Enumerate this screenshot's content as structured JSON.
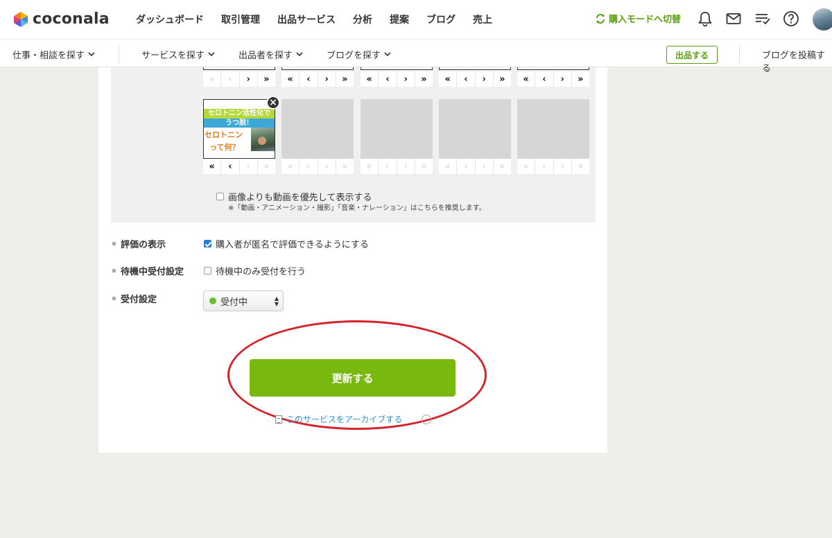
{
  "brand": {
    "name": "coconala"
  },
  "header": {
    "nav": [
      "ダッシュボード",
      "取引管理",
      "出品サービス",
      "分析",
      "提案",
      "ブログ",
      "売上"
    ],
    "mode_switch": "購入モードへ切替",
    "icons": [
      "bell-icon",
      "mail-icon",
      "list-check-icon",
      "help-icon"
    ]
  },
  "subnav": {
    "items": [
      "仕事・相談を探す",
      "サービスを探す",
      "出品者を探す",
      "ブログを探す"
    ],
    "listing_button": "出品する",
    "post_blog": "ブログを投稿する"
  },
  "gallery": {
    "control_symbols": {
      "first": "«",
      "prev": "‹",
      "next": "›",
      "last": "»"
    },
    "thumbnail": {
      "line1": "セロトニン活性化で",
      "line2": "うつ脱！",
      "line3": "セロトニン",
      "line4": "って何？"
    },
    "remove_symbol": "×",
    "video_preference_label": "画像よりも動画を優先して表示する",
    "video_preference_note": "※「動画・アニメーション・撮影」「音楽・ナレーション」はこちらを推奨します。",
    "video_preference_checked": false
  },
  "settings": {
    "review": {
      "label": "評価の表示",
      "option": "購入者が匿名で評価できるようにする",
      "checked": true
    },
    "standby": {
      "label": "待機中受付設定",
      "option": "待機中のみ受付を行う",
      "checked": false
    },
    "reception": {
      "label": "受付設定",
      "selected": "受付中",
      "status_color": "#6cbf2d"
    }
  },
  "actions": {
    "update_button": "更新する",
    "archive_link": "このサービスをアーカイブする"
  },
  "colors": {
    "accent_green": "#79b80f",
    "brand_green_text": "#5a9e0f",
    "highlight_red": "#d6232a"
  }
}
